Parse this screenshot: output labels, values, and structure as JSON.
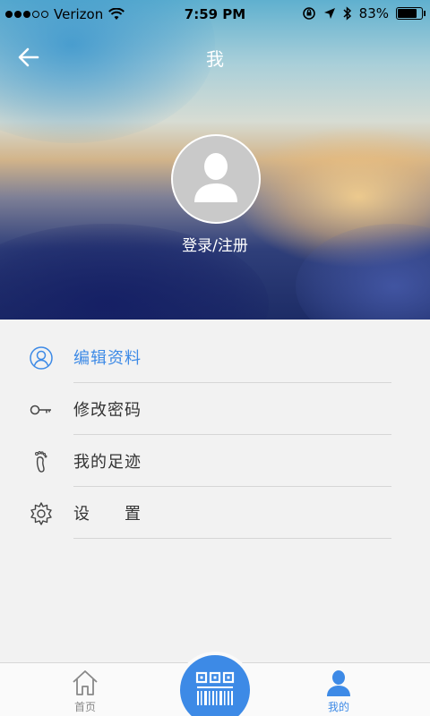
{
  "status_bar": {
    "carrier": "Verizon",
    "time": "7:59 PM",
    "battery": "83%",
    "battery_level": 0.83
  },
  "header": {
    "title": "我",
    "login_label": "登录/注册"
  },
  "menu": {
    "items": [
      {
        "label": "编辑资料",
        "icon": "user-circle-icon"
      },
      {
        "label": "修改密码",
        "icon": "key-icon"
      },
      {
        "label": "我的足迹",
        "icon": "footprint-icon"
      },
      {
        "label": "设　　置",
        "icon": "gear-icon"
      }
    ]
  },
  "tabbar": {
    "home_label": "首页",
    "mine_label": "我的"
  },
  "colors": {
    "accent": "#3d8ae6",
    "text": "#333333",
    "background": "#f2f2f2"
  }
}
